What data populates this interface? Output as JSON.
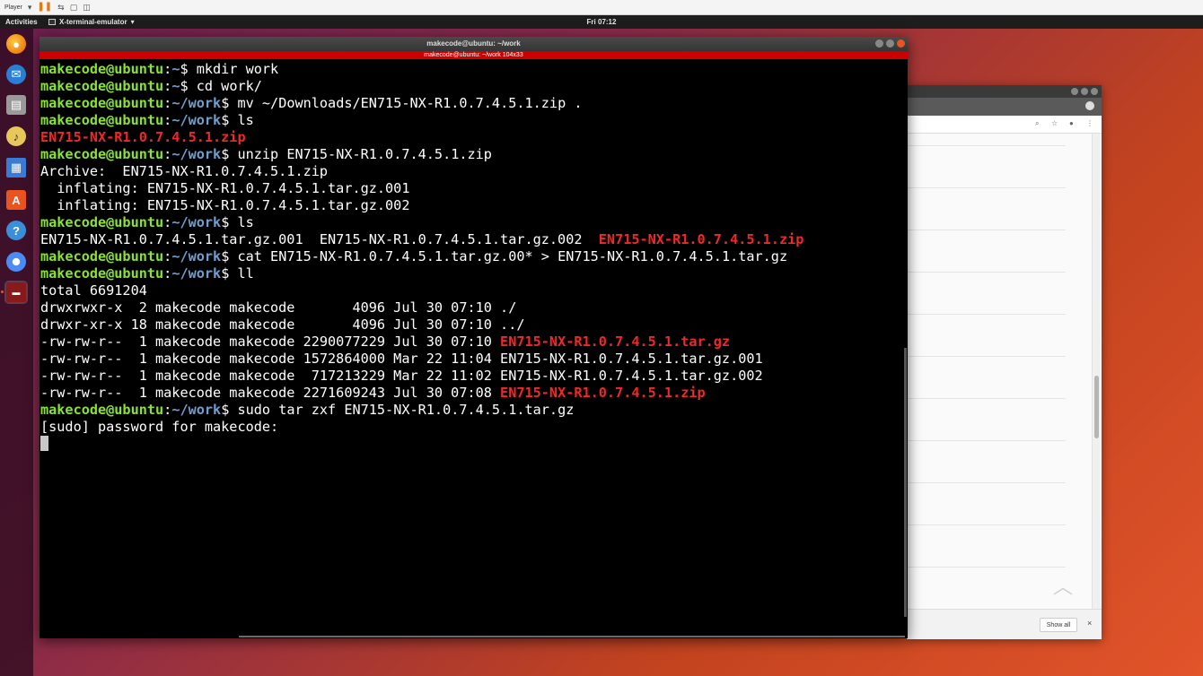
{
  "player": {
    "label": "Player"
  },
  "topbar": {
    "activities": "Activities",
    "app_name": "X-terminal-emulator",
    "clock": "Fri 07:12"
  },
  "dock": {
    "items": [
      {
        "name": "firefox",
        "icon": "firefox-icon",
        "color": "#e66000"
      },
      {
        "name": "thunderbird",
        "icon": "mail-icon",
        "color": "#2a7fd4"
      },
      {
        "name": "files",
        "icon": "file-manager-icon",
        "color": "#b5b5b5"
      },
      {
        "name": "rhythmbox",
        "icon": "music-icon",
        "color": "#e8c85a"
      },
      {
        "name": "writer",
        "icon": "document-icon",
        "color": "#3a7bd5"
      },
      {
        "name": "software",
        "icon": "software-store-icon",
        "color": "#e95420"
      },
      {
        "name": "help",
        "icon": "help-icon",
        "color": "#3a8fd8"
      },
      {
        "name": "chromium",
        "icon": "browser-icon",
        "color": "#4c8bf5"
      },
      {
        "name": "terminal",
        "icon": "terminal-icon",
        "color": "#8a1a1a"
      }
    ]
  },
  "terminal": {
    "title": "makecode@ubuntu: ~/work",
    "resize_info": "makecode@ubuntu: ~/work 104x33",
    "lines": [
      [
        {
          "t": "makecode@ubuntu",
          "c": "u"
        },
        {
          "t": ":",
          "c": ""
        },
        {
          "t": "~",
          "c": "p"
        },
        {
          "t": "$ mkdir work",
          "c": ""
        }
      ],
      [
        {
          "t": "makecode@ubuntu",
          "c": "u"
        },
        {
          "t": ":",
          "c": ""
        },
        {
          "t": "~",
          "c": "p"
        },
        {
          "t": "$ cd work/",
          "c": ""
        }
      ],
      [
        {
          "t": "makecode@ubuntu",
          "c": "u"
        },
        {
          "t": ":",
          "c": ""
        },
        {
          "t": "~/work",
          "c": "p"
        },
        {
          "t": "$ mv ~/Downloads/EN715-NX-R1.0.7.4.5.1.zip .",
          "c": ""
        }
      ],
      [
        {
          "t": "makecode@ubuntu",
          "c": "u"
        },
        {
          "t": ":",
          "c": ""
        },
        {
          "t": "~/work",
          "c": "p"
        },
        {
          "t": "$ ls",
          "c": ""
        }
      ],
      [
        {
          "t": "EN715-NX-R1.0.7.4.5.1.zip",
          "c": "r"
        }
      ],
      [
        {
          "t": "makecode@ubuntu",
          "c": "u"
        },
        {
          "t": ":",
          "c": ""
        },
        {
          "t": "~/work",
          "c": "p"
        },
        {
          "t": "$ unzip EN715-NX-R1.0.7.4.5.1.zip",
          "c": ""
        }
      ],
      [
        {
          "t": "Archive:  EN715-NX-R1.0.7.4.5.1.zip",
          "c": ""
        }
      ],
      [
        {
          "t": "  inflating: EN715-NX-R1.0.7.4.5.1.tar.gz.001",
          "c": ""
        }
      ],
      [
        {
          "t": "  inflating: EN715-NX-R1.0.7.4.5.1.tar.gz.002",
          "c": ""
        }
      ],
      [
        {
          "t": "makecode@ubuntu",
          "c": "u"
        },
        {
          "t": ":",
          "c": ""
        },
        {
          "t": "~/work",
          "c": "p"
        },
        {
          "t": "$ ls",
          "c": ""
        }
      ],
      [
        {
          "t": "EN715-NX-R1.0.7.4.5.1.tar.gz.001  EN715-NX-R1.0.7.4.5.1.tar.gz.002  ",
          "c": ""
        },
        {
          "t": "EN715-NX-R1.0.7.4.5.1.zip",
          "c": "r"
        }
      ],
      [
        {
          "t": "makecode@ubuntu",
          "c": "u"
        },
        {
          "t": ":",
          "c": ""
        },
        {
          "t": "~/work",
          "c": "p"
        },
        {
          "t": "$ cat EN715-NX-R1.0.7.4.5.1.tar.gz.00* > EN715-NX-R1.0.7.4.5.1.tar.gz",
          "c": ""
        }
      ],
      [
        {
          "t": "makecode@ubuntu",
          "c": "u"
        },
        {
          "t": ":",
          "c": ""
        },
        {
          "t": "~/work",
          "c": "p"
        },
        {
          "t": "$ ll",
          "c": ""
        }
      ],
      [
        {
          "t": "total 6691204",
          "c": ""
        }
      ],
      [
        {
          "t": "drwxrwxr-x  2 makecode makecode       4096 Jul 30 07:10 ",
          "c": ""
        },
        {
          "t": "./",
          "c": ""
        }
      ],
      [
        {
          "t": "drwxr-xr-x 18 makecode makecode       4096 Jul 30 07:10 ",
          "c": ""
        },
        {
          "t": "../",
          "c": ""
        }
      ],
      [
        {
          "t": "-rw-rw-r--  1 makecode makecode 2290077229 Jul 30 07:10 ",
          "c": ""
        },
        {
          "t": "EN715-NX-R1.0.7.4.5.1.tar.gz",
          "c": "r"
        }
      ],
      [
        {
          "t": "-rw-rw-r--  1 makecode makecode 1572864000 Mar 22 11:04 EN715-NX-R1.0.7.4.5.1.tar.gz.001",
          "c": ""
        }
      ],
      [
        {
          "t": "-rw-rw-r--  1 makecode makecode  717213229 Mar 22 11:02 EN715-NX-R1.0.7.4.5.1.tar.gz.002",
          "c": ""
        }
      ],
      [
        {
          "t": "-rw-rw-r--  1 makecode makecode 2271609243 Jul 30 07:08 ",
          "c": ""
        },
        {
          "t": "EN715-NX-R1.0.7.4.5.1.zip",
          "c": "r"
        }
      ],
      [
        {
          "t": "makecode@ubuntu",
          "c": "u"
        },
        {
          "t": ":",
          "c": ""
        },
        {
          "t": "~/work",
          "c": "p"
        },
        {
          "t": "$ sudo tar zxf EN715-NX-R1.0.7.4.5.1.tar.gz",
          "c": ""
        }
      ],
      [
        {
          "t": "[sudo] password for makecode: ",
          "c": ""
        }
      ]
    ]
  },
  "background_window": {
    "show_all_label": "Show all",
    "close_label": "×"
  },
  "colors": {
    "prompt_user": "#8ae234",
    "prompt_path": "#729fcf",
    "archive": "#ef2929",
    "terminal_bg": "#000000",
    "resize_bar": "#cc0000"
  }
}
